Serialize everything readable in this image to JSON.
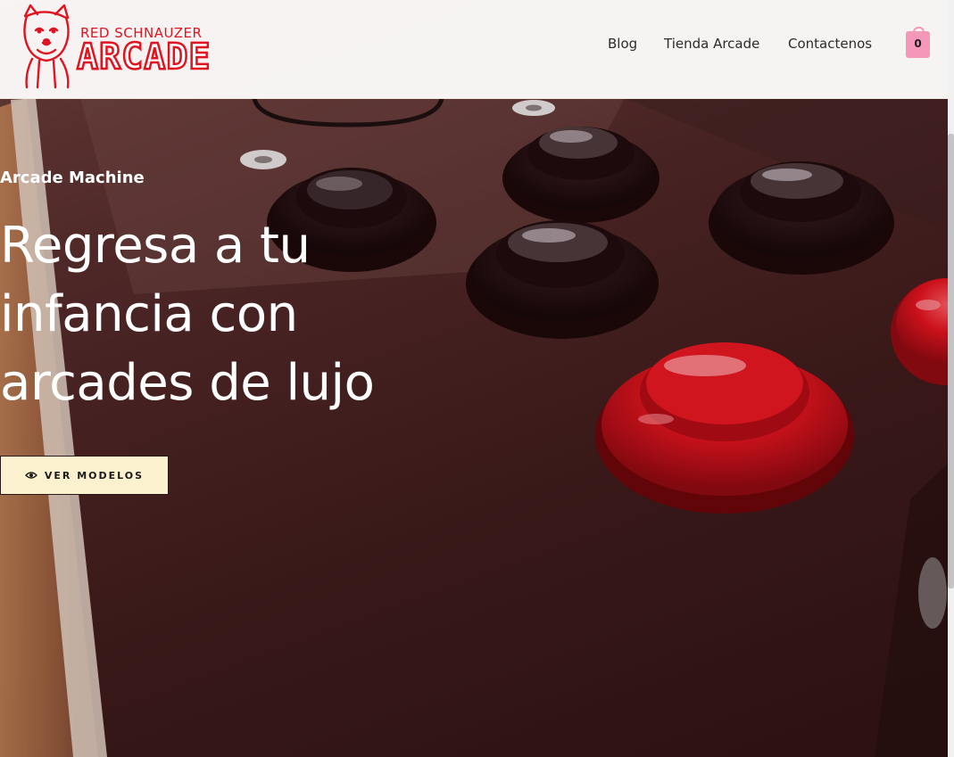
{
  "header": {
    "logo": {
      "top_text": "RED SCHNAUZER",
      "main_text": "ARCADE"
    },
    "nav": [
      {
        "label": "Blog"
      },
      {
        "label": "Tienda Arcade"
      },
      {
        "label": "Contactenos"
      }
    ],
    "cart": {
      "count": "0",
      "icon": "shopping-bag-icon"
    }
  },
  "hero": {
    "eyebrow": "Arcade Machine",
    "headline": [
      "Regresa a tu",
      "infancia con",
      "arcades de lujo"
    ],
    "cta": {
      "label": "VER MODELOS",
      "icon": "eye-icon"
    }
  },
  "colors": {
    "brand_red": "#e0131f",
    "cart_pink": "#f497b9",
    "cta_background": "#fdf2cf"
  }
}
